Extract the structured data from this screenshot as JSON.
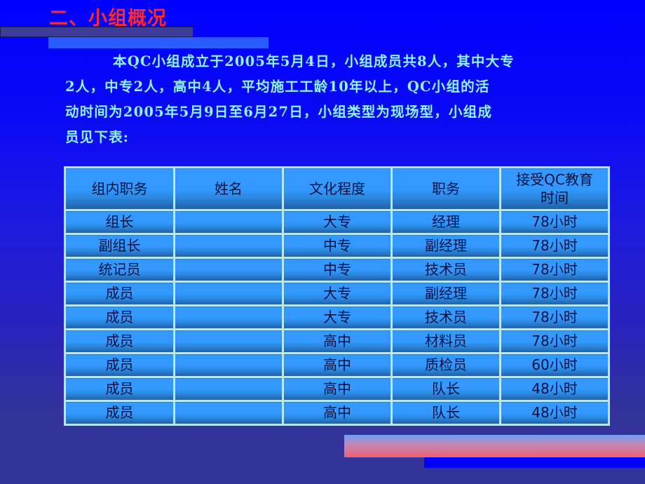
{
  "slide": {
    "title": "二、小组概况",
    "paragraph_lines": [
      "本QC小组成立于2005年5月4日，小组成员共8人，其中大专",
      "2人，中专2人，高中4人，平均施工工龄10年以上，QC小组的活",
      "动时间为2005年5月9日至6月27日，小组类型为现场型，小组成",
      "员见下表:"
    ],
    "colors": {
      "title": "#ff2a2a",
      "paragraph": "#8ff3f0",
      "background_top": "#0000ff",
      "background_bottom": "#333399",
      "table_cell": "#3399ff",
      "table_border": "#b8e8f2"
    }
  },
  "table": {
    "headers": [
      "组内职务",
      "姓名",
      "文化程度",
      "职务",
      "接受QC教育时间"
    ],
    "header_last_lines": [
      "接受QC教育",
      "时间"
    ],
    "rows": [
      {
        "role": "组长",
        "name": "",
        "education": "大专",
        "position": "经理",
        "training": "78小时"
      },
      {
        "role": "副组长",
        "name": "",
        "education": "中专",
        "position": "副经理",
        "training": "78小时"
      },
      {
        "role": "统记员",
        "name": "",
        "education": "中专",
        "position": "技术员",
        "training": "78小时"
      },
      {
        "role": "成员",
        "name": "",
        "education": "大专",
        "position": "副经理",
        "training": "78小时"
      },
      {
        "role": "成员",
        "name": "",
        "education": "大专",
        "position": "技术员",
        "training": "78小时"
      },
      {
        "role": "成员",
        "name": "",
        "education": "高中",
        "position": "材料员",
        "training": "78小时"
      },
      {
        "role": "成员",
        "name": "",
        "education": "高中",
        "position": "质检员",
        "training": "60小时"
      },
      {
        "role": "成员",
        "name": "",
        "education": "高中",
        "position": "队长",
        "training": "48小时"
      },
      {
        "role": "成员",
        "name": "",
        "education": "高中",
        "position": "队长",
        "training": "48小时"
      }
    ]
  }
}
